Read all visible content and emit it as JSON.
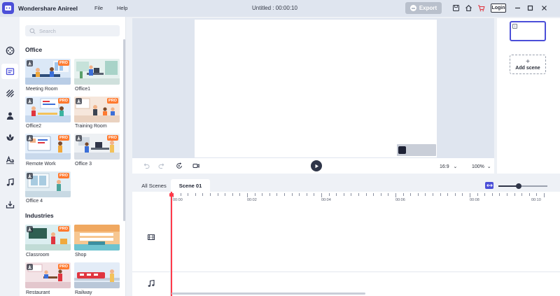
{
  "app": {
    "name": "Wondershare Anireel",
    "document_title": "Untitled : 00:00:10",
    "menu": [
      "File",
      "Help"
    ],
    "export_label": "Export",
    "login_label": "Login",
    "accent_color": "#4b4fd8",
    "pro_color": "#ff7a2f"
  },
  "icons": {
    "toolbar": [
      "save-icon",
      "home-icon",
      "cart-icon"
    ],
    "window": [
      "minimize-icon",
      "maximize-icon",
      "close-icon"
    ],
    "rail": [
      "film-reel-icon",
      "template-icon",
      "background-icon",
      "character-icon",
      "prop-icon",
      "text-icon",
      "music-icon",
      "import-icon"
    ]
  },
  "panel": {
    "search_placeholder": "Search",
    "sections": [
      {
        "title": "Office",
        "items": [
          {
            "label": "Meeting Room",
            "pro": true,
            "download": true
          },
          {
            "label": "Office1",
            "pro": false,
            "download": false
          },
          {
            "label": "Office2",
            "pro": true,
            "download": true
          },
          {
            "label": "Training Room",
            "pro": true,
            "download": true
          },
          {
            "label": "Remote Work",
            "pro": true,
            "download": true
          },
          {
            "label": "Office 3",
            "pro": true,
            "download": true
          },
          {
            "label": "Office 4",
            "pro": true,
            "download": true
          }
        ]
      },
      {
        "title": "Industries",
        "items": [
          {
            "label": "Classroom",
            "pro": true,
            "download": true
          },
          {
            "label": "Shop",
            "pro": false,
            "download": false
          },
          {
            "label": "Restaurant",
            "pro": true,
            "download": true
          },
          {
            "label": "Railway",
            "pro": false,
            "download": false
          }
        ]
      }
    ],
    "pro_badge": "PRO"
  },
  "stage": {
    "aspect_ratio": "16:9",
    "zoom": "100%"
  },
  "scenes": {
    "current_number": "1",
    "add_label": "Add scene"
  },
  "timeline": {
    "tabs": [
      "All Scenes",
      "Scene 01"
    ],
    "active_tab": "Scene 01",
    "ruler_labels": [
      "00:00",
      "00:02",
      "00:04",
      "00:06",
      "00:08",
      "00:10"
    ]
  }
}
